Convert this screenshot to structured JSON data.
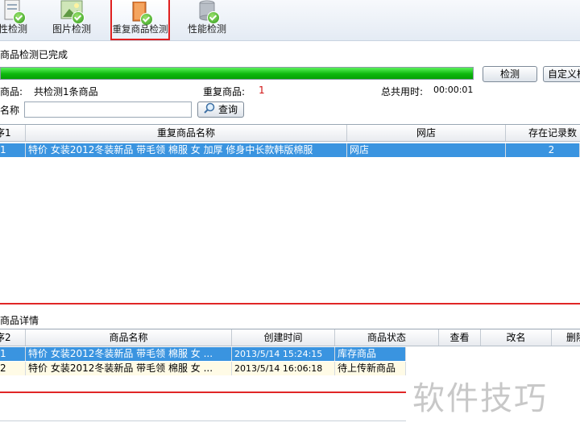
{
  "toolbar": {
    "items": [
      {
        "label": "性检测",
        "icon": "document-check-icon"
      },
      {
        "label": "图片检测",
        "icon": "picture-check-icon"
      },
      {
        "label": "重复商品检测",
        "icon": "book-check-icon",
        "active": true
      },
      {
        "label": "性能检测",
        "icon": "server-check-icon"
      }
    ]
  },
  "status": {
    "done_text": "商品检测已完成",
    "progress": 1.0,
    "detect_button": "检测",
    "custom_button": "自定义检",
    "goods_label": "商品:",
    "goods_value": "共检测1条商品",
    "dup_label": "重复商品:",
    "dup_value": "1",
    "time_label": "总共用时:",
    "time_value": "00:00:01"
  },
  "search": {
    "label": "名称",
    "value": "",
    "button": "查询"
  },
  "dup_grid": {
    "headers": [
      "序1",
      "重复商品名称",
      "网店",
      "存在记录数"
    ],
    "rows": [
      {
        "index": "1",
        "name": "特价 女装2012冬装新品 带毛领 棉服 女 加厚 修身中长款韩版棉服",
        "shop": "网店",
        "count": "2"
      }
    ]
  },
  "detail": {
    "title": "商品详情",
    "headers": [
      "序2",
      "商品名称",
      "创建时间",
      "商品状态",
      "查看",
      "改名",
      "删除"
    ],
    "rows": [
      {
        "index": "1",
        "name": "特价 女装2012冬装新品 带毛领 棉服 女 ...",
        "time": "2013/5/14 15:24:15",
        "status": "库存商品"
      },
      {
        "index": "2",
        "name": "特价 女装2012冬装新品 带毛领 棉服 女 ...",
        "time": "2013/5/14 16:06:18",
        "status": "待上传新商品"
      }
    ]
  },
  "watermark": "软件技巧",
  "colors": {
    "accent_red": "#e02020",
    "selection": "#3a94e0",
    "progress_green": "#0eb80e"
  }
}
